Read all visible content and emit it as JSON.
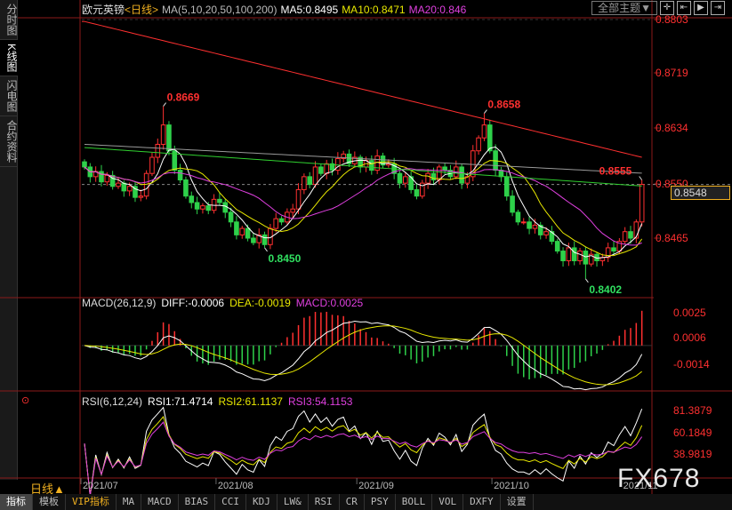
{
  "sidebar": {
    "tabs": [
      "分时图",
      "K线图",
      "闪电图",
      "合约资料"
    ],
    "active": 1
  },
  "header": {
    "symbol": "欧元英镑",
    "period": "<日线>",
    "ma_params": "MA(5,10,20,50,100,200)",
    "ma5": "MA5:0.8495",
    "ma10": "MA10:0.8471",
    "ma20": "MA20:0.846",
    "theme": "全部主题▼"
  },
  "macd_header": {
    "params": "MACD(26,12,9)",
    "diff": "DIFF:-0.0006",
    "dea": "DEA:-0.0019",
    "macd": "MACD:0.0025"
  },
  "rsi_header": {
    "params": "RSI(6,12,24)",
    "rsi1": "RSI1:71.4714",
    "rsi2": "RSI2:61.1137",
    "rsi3": "RSI3:54.1153"
  },
  "price_axis": [
    "0.8803",
    "0.8719",
    "0.8634",
    "0.8550",
    "0.8465"
  ],
  "macd_axis": [
    "0.0025",
    "0.0006",
    "-0.0014"
  ],
  "rsi_axis": [
    "81.3879",
    "60.1849",
    "38.9819"
  ],
  "current_price": "0.8548",
  "period_label": "日线▲",
  "watermark": "FX678",
  "bottom_tabs": [
    "指标",
    "模板",
    "VIP指标",
    "MA",
    "MACD",
    "BIAS",
    "CCI",
    "KDJ",
    "LW&",
    "RSI",
    "CR",
    "PSY",
    "BOLL",
    "VOL",
    "DXFY",
    "设置"
  ],
  "colors": {
    "up": "#ff3030",
    "down": "#2ed14a",
    "ma5": "#ffffff",
    "ma10": "#e8e800",
    "ma20": "#e040e0",
    "ma50": "#30d030",
    "ma100": "#999999",
    "ma200": "#ff3030"
  },
  "chart_data": {
    "type": "candlestick",
    "title": "欧元英镑 日线",
    "ylim": [
      0.844,
      0.8803
    ],
    "x_ticks": [
      {
        "i": 0,
        "label": "2021/07"
      },
      {
        "i": 24,
        "label": "2021/08"
      },
      {
        "i": 49,
        "label": "2021/09"
      },
      {
        "i": 73,
        "label": "2021/10"
      },
      {
        "i": 96,
        "label": "2021/11"
      }
    ],
    "closes": [
      0.8575,
      0.856,
      0.8568,
      0.8552,
      0.8562,
      0.8545,
      0.855,
      0.8538,
      0.8545,
      0.8528,
      0.853,
      0.8565,
      0.859,
      0.861,
      0.864,
      0.86,
      0.857,
      0.8555,
      0.853,
      0.852,
      0.851,
      0.8515,
      0.8508,
      0.8525,
      0.852,
      0.8505,
      0.849,
      0.847,
      0.848,
      0.8465,
      0.8458,
      0.847,
      0.8455,
      0.848,
      0.8495,
      0.849,
      0.8505,
      0.851,
      0.854,
      0.856,
      0.8548,
      0.8575,
      0.8565,
      0.858,
      0.857,
      0.8588,
      0.8595,
      0.858,
      0.859,
      0.8575,
      0.8585,
      0.857,
      0.8592,
      0.8578,
      0.858,
      0.8565,
      0.855,
      0.856,
      0.854,
      0.853,
      0.855,
      0.8565,
      0.8555,
      0.8575,
      0.857,
      0.856,
      0.8575,
      0.855,
      0.856,
      0.86,
      0.862,
      0.864,
      0.86,
      0.857,
      0.856,
      0.853,
      0.8505,
      0.849,
      0.849,
      0.848,
      0.8485,
      0.847,
      0.8475,
      0.846,
      0.8445,
      0.843,
      0.845,
      0.843,
      0.8445,
      0.8425,
      0.844,
      0.843,
      0.8435,
      0.845,
      0.8445,
      0.846,
      0.8475,
      0.8465,
      0.849,
      0.8548
    ],
    "ma200_range": [
      0.88,
      0.859
    ],
    "annotations": [
      {
        "i": 14,
        "type": "high",
        "value": "0.8669"
      },
      {
        "i": 32,
        "type": "low",
        "value": "0.8450"
      },
      {
        "i": 71,
        "type": "high",
        "value": "0.8658"
      },
      {
        "i": 89,
        "type": "low",
        "value": "0.8402"
      },
      {
        "i": 99,
        "type": "high",
        "value": "0.8555"
      }
    ],
    "macd_ylim": [
      -0.0035,
      0.0033
    ],
    "rsi_ylim": [
      10,
      95
    ]
  }
}
